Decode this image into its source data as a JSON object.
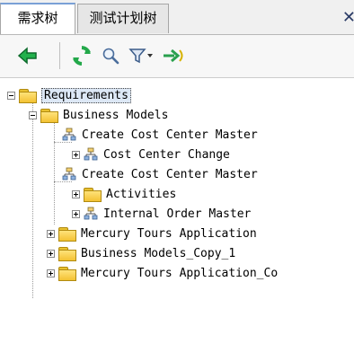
{
  "tabs": [
    {
      "label": "需求树",
      "active": true
    },
    {
      "label": "测试计划树",
      "active": false
    }
  ],
  "toolbar": {
    "icons": [
      "back-arrow-icon",
      "refresh-icon",
      "search-icon",
      "filter-icon",
      "chevron-down-icon",
      "go-to-icon"
    ]
  },
  "tree": {
    "root": "Requirements",
    "business_models": "Business Models",
    "create_cost_center_master_1": "Create Cost Center Master",
    "cost_center_change": "Cost Center Change",
    "create_cost_center_master_2": "Create Cost Center Master",
    "activities": "Activities",
    "internal_order_master": "Internal Order Master",
    "mercury_tours_application": "Mercury Tours Application",
    "business_models_copy_1": "Business Models_Copy_1",
    "mercury_tours_application_co": "Mercury Tours Application_Co"
  },
  "colors": {
    "folder": "#f3c233",
    "back_arrow": "#1aa04a",
    "refresh": "#23a84a",
    "tab_accent": "#7aa0d6"
  }
}
